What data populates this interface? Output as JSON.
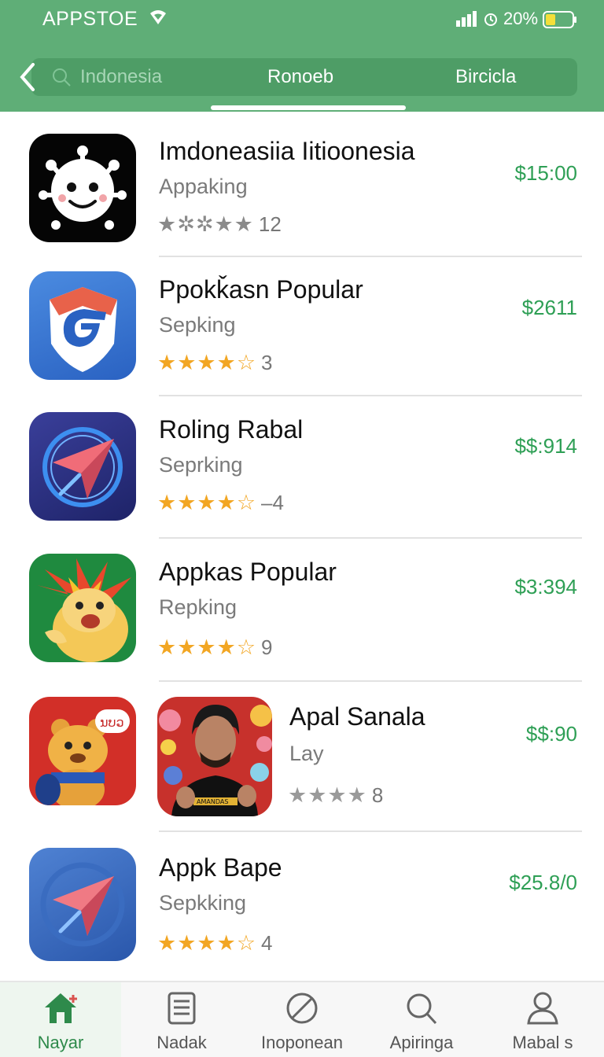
{
  "status": {
    "app_name": "APPSTOE",
    "battery": "20%"
  },
  "nav": {
    "items": [
      "Indonesia",
      "Ronoeb",
      "Bircicla"
    ]
  },
  "apps": [
    {
      "title": "Imdoneasiia Iitioonesia",
      "subtitle": "Appaking",
      "stars": "★✲✲★★",
      "count": "12",
      "price": "$15:00",
      "icon": "virus-face-icon"
    },
    {
      "title": "Ppokǩasn Popular",
      "subtitle": "Sepking",
      "stars": "★★★★☆",
      "count": "3",
      "price": "$2611",
      "icon": "g-logo-icon"
    },
    {
      "title": "Roling Rabal",
      "subtitle": "Seprking",
      "stars": "★★★★☆",
      "count": "–4",
      "price": "$$:914",
      "icon": "paper-plane-icon"
    },
    {
      "title": "Appkas Popular",
      "subtitle": "Repking",
      "stars": "★★★★☆",
      "count": "9",
      "price": "$3:394",
      "icon": "lion-mascot-icon"
    },
    {
      "title": "Apal Sanala",
      "subtitle": "Lay",
      "stars": "★★★★",
      "count": "8",
      "price": "$$:90",
      "icon": "bear-mascot-icon",
      "icon2": "person-photo-icon",
      "badge": "ນບວ",
      "shirt": "AMANDAS"
    },
    {
      "title": "Appk Bape",
      "subtitle": "Sepkking",
      "stars": "★★★★☆",
      "count": "4",
      "price": "$25.8/0",
      "icon": "paper-plane-icon"
    }
  ],
  "bottom_nav": [
    {
      "label": "Nayar",
      "icon": "home-icon",
      "active": true
    },
    {
      "label": "Nadak",
      "icon": "newspaper-icon",
      "active": false
    },
    {
      "label": "Inoponean",
      "icon": "blocked-icon",
      "active": false
    },
    {
      "label": "Apiringa",
      "icon": "search-icon",
      "active": false
    },
    {
      "label": "Mabal s",
      "icon": "profile-icon",
      "active": false
    }
  ],
  "colors": {
    "header": "#5fae77",
    "price": "#2e9f55",
    "star": "#f2a623",
    "star_gray": "#999999"
  }
}
